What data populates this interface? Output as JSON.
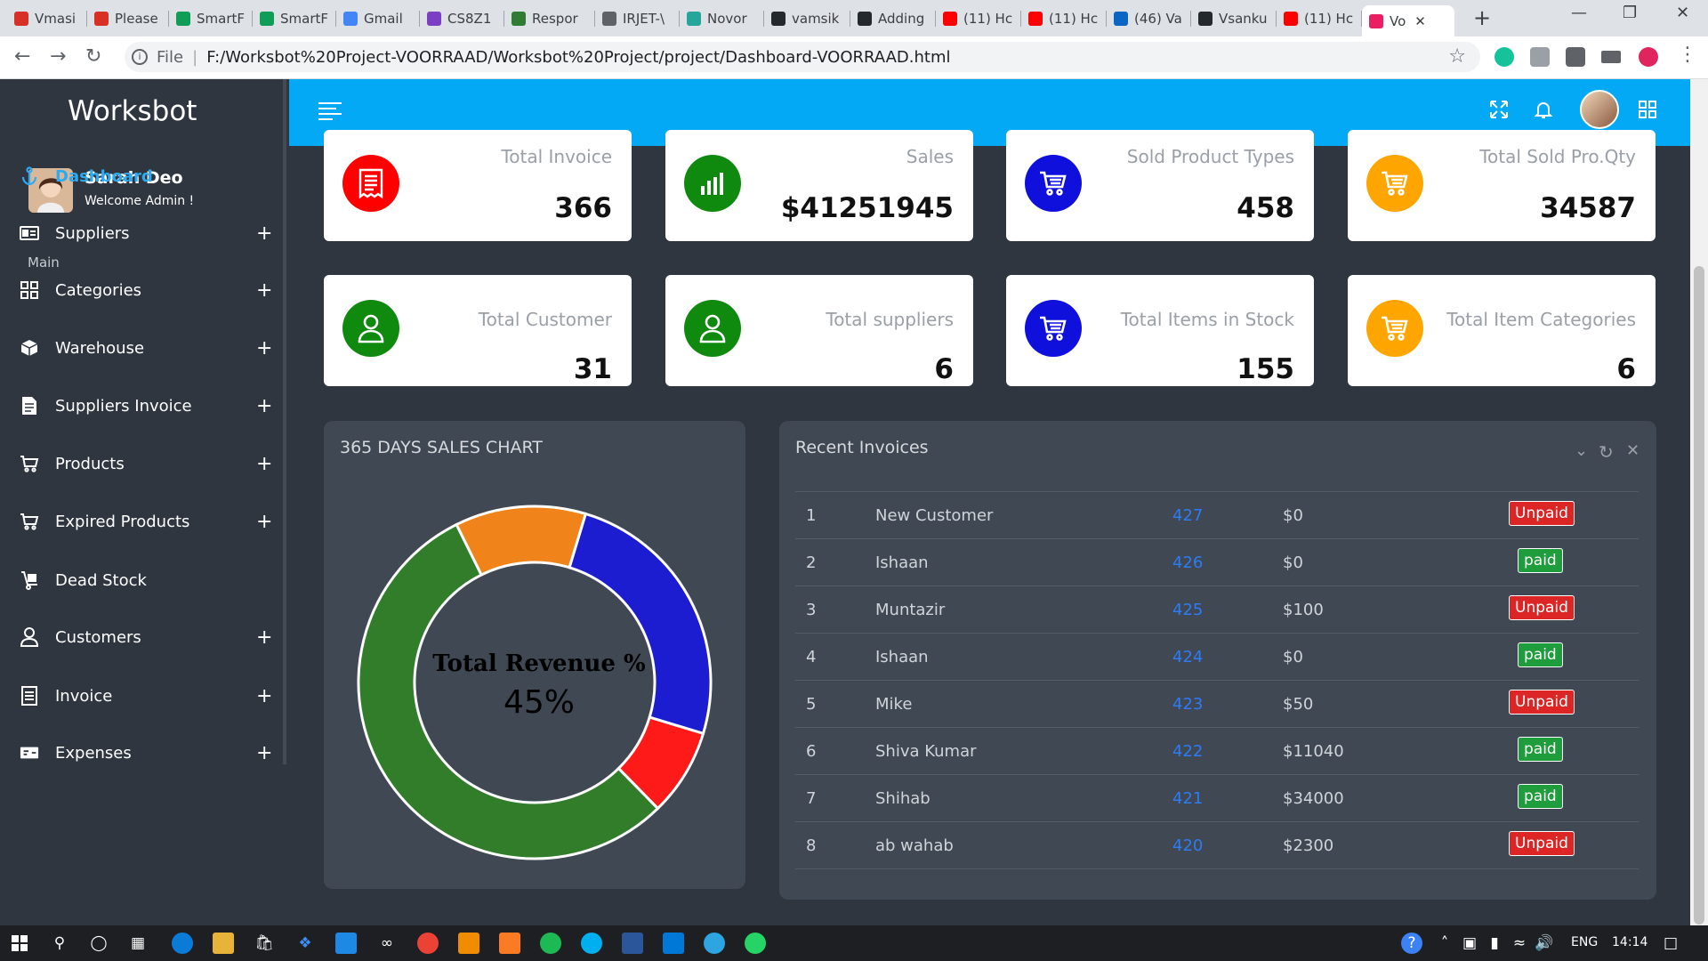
{
  "browser": {
    "tabs": [
      {
        "title": "Vmasi",
        "color": "#d93025"
      },
      {
        "title": "Please",
        "color": "#d93025"
      },
      {
        "title": "SmartF",
        "color": "#0f9d58"
      },
      {
        "title": "SmartF",
        "color": "#0f9d58"
      },
      {
        "title": "Gmail",
        "color": "#4285f4"
      },
      {
        "title": "CS8Z1",
        "color": "#7b3fc4"
      },
      {
        "title": "Respor",
        "color": "#2e7d32"
      },
      {
        "title": "IRJET-\\",
        "color": "#5f6368"
      },
      {
        "title": "Novor",
        "color": "#26a69a"
      },
      {
        "title": "vamsik",
        "color": "#24292e"
      },
      {
        "title": "Adding",
        "color": "#24292e"
      },
      {
        "title": "(11) Hc",
        "color": "#ff0000"
      },
      {
        "title": "(11) Hc",
        "color": "#ff0000"
      },
      {
        "title": "(46) Va",
        "color": "#0a66c2"
      },
      {
        "title": "Vsanku",
        "color": "#24292e"
      },
      {
        "title": "(11) Hc",
        "color": "#ff0000"
      },
      {
        "title": "Vo",
        "color": "#e91e63"
      }
    ],
    "file_label": "File",
    "url": "F:/Worksbot%20Project-VOORRAAD/Worksbot%20Project/project/Dashboard-VOORRAAD.html"
  },
  "sidebar": {
    "brand": "Worksbot",
    "user_name": "Sarah Deo",
    "user_welcome": "Welcome Admin !",
    "section_label": "Main",
    "items": [
      {
        "label": "Dashboard",
        "icon": "anchor-icon",
        "plus": ""
      },
      {
        "label": "Suppliers",
        "icon": "id-card-icon",
        "plus": "+"
      },
      {
        "label": "Categories",
        "icon": "grid-icon",
        "plus": "+"
      },
      {
        "label": "Warehouse",
        "icon": "box-icon",
        "plus": "+"
      },
      {
        "label": "Suppliers Invoice",
        "icon": "document-icon",
        "plus": "+"
      },
      {
        "label": "Products",
        "icon": "cart-icon",
        "plus": "+"
      },
      {
        "label": "Expired Products",
        "icon": "cart-icon",
        "plus": "+"
      },
      {
        "label": "Dead Stock",
        "icon": "dolly-icon",
        "plus": ""
      },
      {
        "label": "Customers",
        "icon": "user-icon",
        "plus": "+"
      },
      {
        "label": "Invoice",
        "icon": "invoice-icon",
        "plus": "+"
      },
      {
        "label": "Expenses",
        "icon": "money-icon",
        "plus": "+"
      }
    ]
  },
  "stats": [
    {
      "title": "Total Invoice",
      "value": "366",
      "color": "#ff0000",
      "icon": "receipt-icon"
    },
    {
      "title": "Sales",
      "value": "$41251945",
      "color": "#0f8a0f",
      "icon": "bar-chart-icon"
    },
    {
      "title": "Sold Product Types",
      "value": "458",
      "color": "#1010dd",
      "icon": "cart-icon"
    },
    {
      "title": "Total Sold Pro.Qty",
      "value": "34587",
      "color": "#ffa500",
      "icon": "cart-icon"
    },
    {
      "title": "Total Customer",
      "value": "31",
      "color": "#0f8a0f",
      "icon": "user-icon"
    },
    {
      "title": "Total suppliers",
      "value": "6",
      "color": "#0f8a0f",
      "icon": "user-icon"
    },
    {
      "title": "Total Items in Stock",
      "value": "155",
      "color": "#1010dd",
      "icon": "cart-icon"
    },
    {
      "title": "Total Item Categories",
      "value": "6",
      "color": "#ffa500",
      "icon": "cart-icon"
    }
  ],
  "sales_chart": {
    "title": "365 DAYS SALES CHART",
    "center_label": "Total Revenue %",
    "center_value": "45%",
    "chart_data": {
      "type": "pie",
      "title": "",
      "slices": [
        {
          "color": "#f0841a",
          "value": 12
        },
        {
          "color": "#1c1cd0",
          "value": 25
        },
        {
          "color": "#ff1a1a",
          "value": 8
        },
        {
          "color": "#317d2a",
          "value": 55
        }
      ]
    }
  },
  "invoices": {
    "title": "Recent Invoices",
    "rows": [
      {
        "n": "1",
        "name": "New Customer",
        "id": "427",
        "amount": "$0",
        "status": "Unpaid"
      },
      {
        "n": "2",
        "name": "Ishaan",
        "id": "426",
        "amount": "$0",
        "status": "paid"
      },
      {
        "n": "3",
        "name": "Muntazir",
        "id": "425",
        "amount": "$100",
        "status": "Unpaid"
      },
      {
        "n": "4",
        "name": "Ishaan",
        "id": "424",
        "amount": "$0",
        "status": "paid"
      },
      {
        "n": "5",
        "name": "Mike",
        "id": "423",
        "amount": "$50",
        "status": "Unpaid"
      },
      {
        "n": "6",
        "name": "Shiva Kumar",
        "id": "422",
        "amount": "$11040",
        "status": "paid"
      },
      {
        "n": "7",
        "name": "Shihab",
        "id": "421",
        "amount": "$34000",
        "status": "paid"
      },
      {
        "n": "8",
        "name": "ab wahab",
        "id": "420",
        "amount": "$2300",
        "status": "Unpaid"
      }
    ]
  },
  "taskbar": {
    "lang": "ENG",
    "time": "14:14"
  }
}
